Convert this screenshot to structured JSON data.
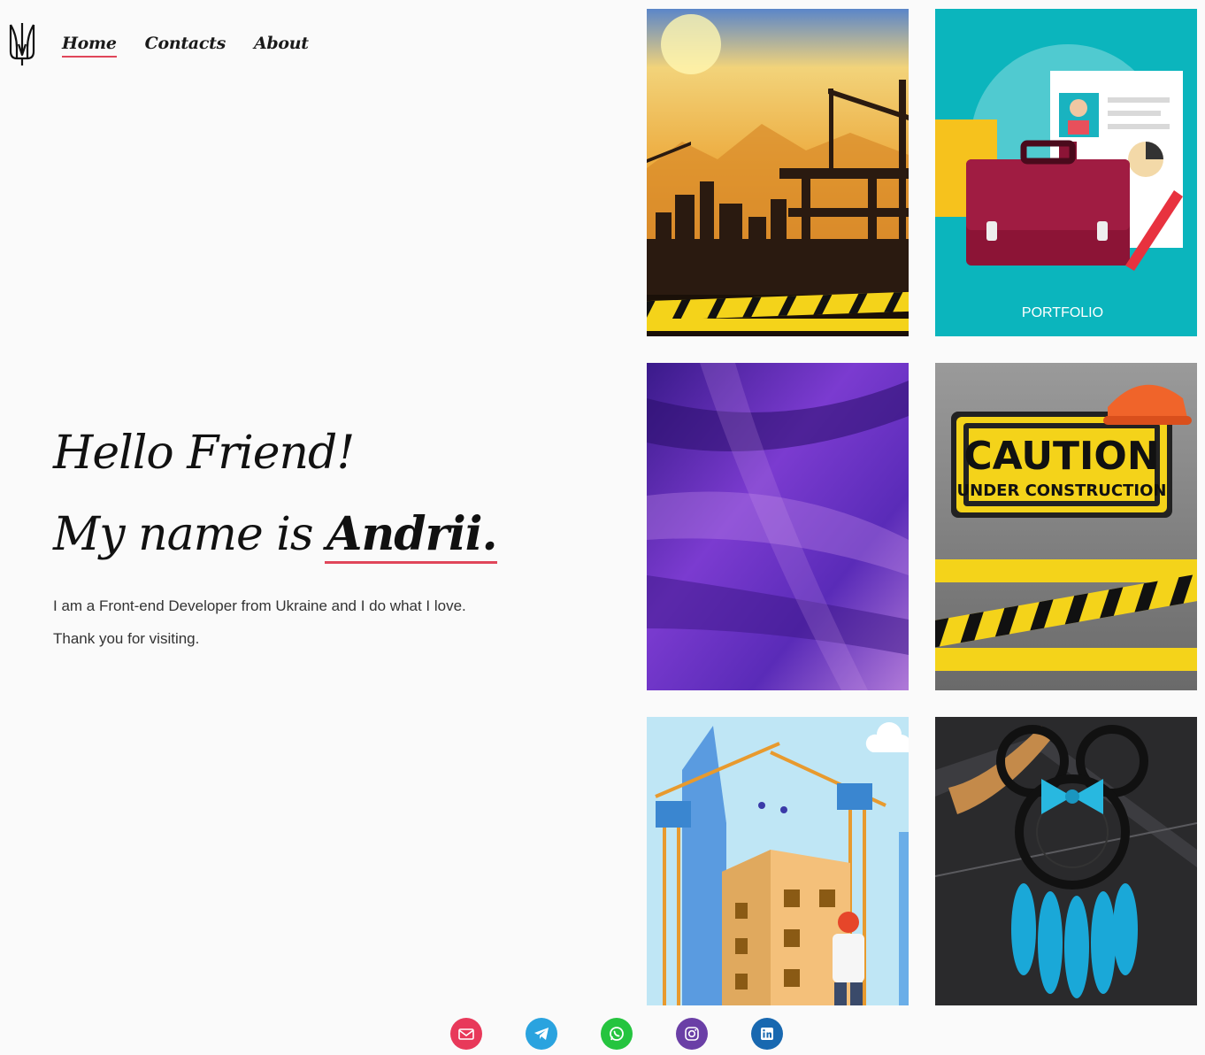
{
  "nav": {
    "logo_icon": "trident-icon",
    "items": [
      {
        "label": "Home",
        "active": true
      },
      {
        "label": "Contacts",
        "active": false
      },
      {
        "label": "About",
        "active": false
      }
    ]
  },
  "hero": {
    "line1": "Hello Friend!",
    "line2_prefix": "My name is ",
    "name": "Andrii.",
    "intro": "I am a Front-end Developer from Ukraine and I do what I love.",
    "thanks": "Thank you for visiting."
  },
  "gallery": [
    {
      "icon": "construction-sunset-image"
    },
    {
      "icon": "portfolio-briefcase-image",
      "caption": "PORTFOLIO"
    },
    {
      "icon": "purple-feathers-image"
    },
    {
      "icon": "caution-sign-image",
      "sign_title": "CAUTION",
      "sign_subtitle": "UNDER CONSTRUCTION"
    },
    {
      "icon": "building-cranes-image"
    },
    {
      "icon": "dreamcatcher-image"
    }
  ],
  "social": [
    {
      "icon": "mail-icon",
      "color": "#e8395a"
    },
    {
      "icon": "telegram-icon",
      "color": "#2aa3df"
    },
    {
      "icon": "whatsapp-icon",
      "color": "#25c43f"
    },
    {
      "icon": "instagram-icon",
      "color": "#6a3fa6"
    },
    {
      "icon": "linkedin-icon",
      "color": "#1868b0"
    }
  ],
  "colors": {
    "accent": "#e0465a",
    "background": "#fafafa"
  }
}
